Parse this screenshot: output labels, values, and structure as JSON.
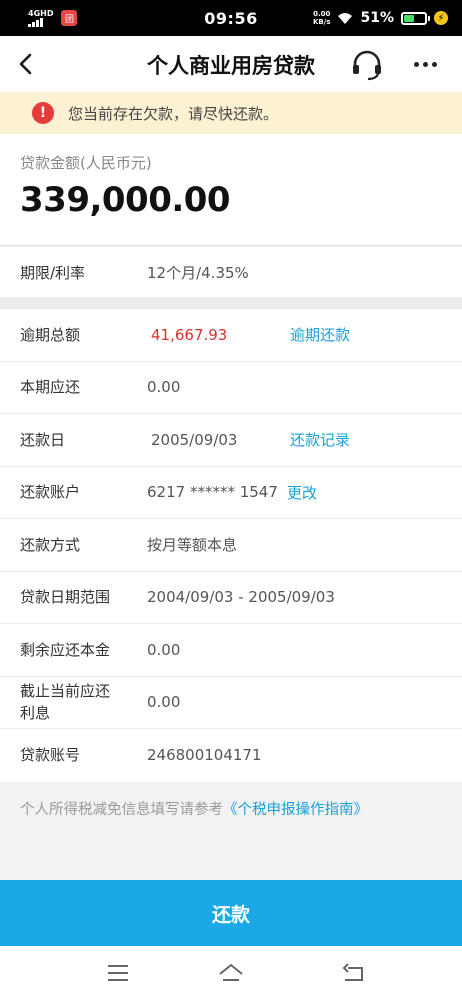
{
  "status_bar": {
    "network": "4GHD",
    "time": "09:56",
    "speed_value": "0.00",
    "speed_unit": "KB/s",
    "battery": "51%",
    "app_badge": "团"
  },
  "nav": {
    "title": "个人商业用房贷款",
    "back_icon": "chevron-left-icon",
    "service_icon": "headset-icon",
    "more_icon": "more-dots-icon"
  },
  "warning": {
    "icon": "!",
    "text": "您当前存在欠款，请尽快还款。"
  },
  "amount": {
    "label": "贷款金额(人民币元)",
    "value": "339,000.00"
  },
  "term": {
    "label": "期限/利率",
    "value": "12个月/4.35%"
  },
  "details": [
    {
      "label": "逾期总额",
      "value": "41,667.93",
      "action": "逾期还款"
    },
    {
      "label": "本期应还",
      "value": "0.00"
    },
    {
      "label": "还款日",
      "value": "2005/09/03",
      "action": "还款记录"
    },
    {
      "label": "还款账户",
      "value": "6217 ****** 1547",
      "action": "更改"
    },
    {
      "label": "还款方式",
      "value": "按月等额本息"
    },
    {
      "label": "贷款日期范围",
      "value": "2004/09/03 - 2005/09/03"
    },
    {
      "label": "剩余应还本金",
      "value": "0.00"
    },
    {
      "label": "截止当前应还利息",
      "value": "0.00"
    },
    {
      "label": "贷款账号",
      "value": "246800104171"
    }
  ],
  "tax_note": {
    "text": "个人所得税减免信息填写请参考",
    "link": "《个税申报操作指南》"
  },
  "pay_button": "还款",
  "colors": {
    "accent": "#1aa8e6",
    "link": "#1aa0d8",
    "overdue": "#d9302c",
    "warning_bg": "#fcf1d2"
  }
}
